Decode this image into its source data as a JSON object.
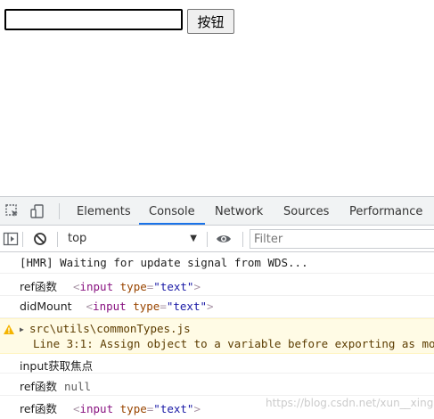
{
  "page": {
    "input_value": "",
    "button_label": "按钮"
  },
  "devtools": {
    "tabs": [
      {
        "label": "Elements",
        "active": false
      },
      {
        "label": "Console",
        "active": true
      },
      {
        "label": "Network",
        "active": false
      },
      {
        "label": "Sources",
        "active": false
      },
      {
        "label": "Performance",
        "active": false
      }
    ],
    "context": "top",
    "filter_placeholder": "Filter",
    "accent_color": "#1a73e8",
    "icons": [
      "inspect-element-icon",
      "device-toggle-icon",
      "sidebar-toggle-icon",
      "clear-console-icon",
      "dropdown-arrow-icon",
      "eye-icon",
      "warning-icon",
      "expand-triangle-icon"
    ]
  },
  "console": {
    "hmr": "[HMR] Waiting for update signal from WDS...",
    "log1_prefix": "ref函数",
    "log2_prefix": "didMount",
    "input_tag": "input",
    "type_attr": "type",
    "type_value": "\"text\"",
    "open_bracket": "<",
    "close_bracket": ">",
    "eq": "=",
    "warn_file": "src\\utils\\commonTypes.js",
    "warn_message": "Line 3:1:  Assign object to a variable before exporting as mo",
    "log3": "input获取焦点",
    "log4_prefix": "ref函数",
    "log4_value": "null",
    "log5_prefix": "ref函数"
  },
  "watermark": "https://blog.csdn.net/xun__xing"
}
